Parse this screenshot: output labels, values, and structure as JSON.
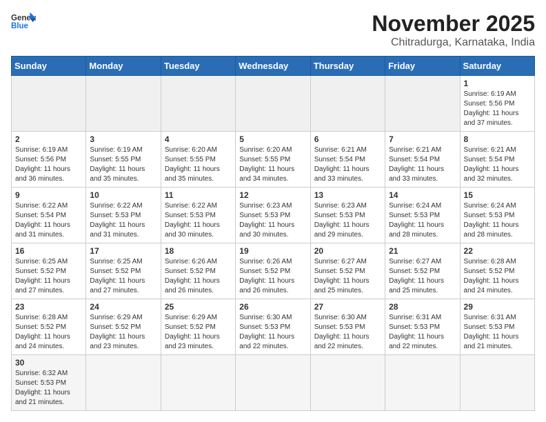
{
  "header": {
    "logo_general": "General",
    "logo_blue": "Blue",
    "month_title": "November 2025",
    "location": "Chitradurga, Karnataka, India"
  },
  "weekdays": [
    "Sunday",
    "Monday",
    "Tuesday",
    "Wednesday",
    "Thursday",
    "Friday",
    "Saturday"
  ],
  "weeks": [
    [
      {
        "day": "",
        "info": ""
      },
      {
        "day": "",
        "info": ""
      },
      {
        "day": "",
        "info": ""
      },
      {
        "day": "",
        "info": ""
      },
      {
        "day": "",
        "info": ""
      },
      {
        "day": "",
        "info": ""
      },
      {
        "day": "1",
        "info": "Sunrise: 6:19 AM\nSunset: 5:56 PM\nDaylight: 11 hours\nand 37 minutes."
      }
    ],
    [
      {
        "day": "2",
        "info": "Sunrise: 6:19 AM\nSunset: 5:56 PM\nDaylight: 11 hours\nand 36 minutes."
      },
      {
        "day": "3",
        "info": "Sunrise: 6:19 AM\nSunset: 5:55 PM\nDaylight: 11 hours\nand 35 minutes."
      },
      {
        "day": "4",
        "info": "Sunrise: 6:20 AM\nSunset: 5:55 PM\nDaylight: 11 hours\nand 35 minutes."
      },
      {
        "day": "5",
        "info": "Sunrise: 6:20 AM\nSunset: 5:55 PM\nDaylight: 11 hours\nand 34 minutes."
      },
      {
        "day": "6",
        "info": "Sunrise: 6:21 AM\nSunset: 5:54 PM\nDaylight: 11 hours\nand 33 minutes."
      },
      {
        "day": "7",
        "info": "Sunrise: 6:21 AM\nSunset: 5:54 PM\nDaylight: 11 hours\nand 33 minutes."
      },
      {
        "day": "8",
        "info": "Sunrise: 6:21 AM\nSunset: 5:54 PM\nDaylight: 11 hours\nand 32 minutes."
      }
    ],
    [
      {
        "day": "9",
        "info": "Sunrise: 6:22 AM\nSunset: 5:54 PM\nDaylight: 11 hours\nand 31 minutes."
      },
      {
        "day": "10",
        "info": "Sunrise: 6:22 AM\nSunset: 5:53 PM\nDaylight: 11 hours\nand 31 minutes."
      },
      {
        "day": "11",
        "info": "Sunrise: 6:22 AM\nSunset: 5:53 PM\nDaylight: 11 hours\nand 30 minutes."
      },
      {
        "day": "12",
        "info": "Sunrise: 6:23 AM\nSunset: 5:53 PM\nDaylight: 11 hours\nand 30 minutes."
      },
      {
        "day": "13",
        "info": "Sunrise: 6:23 AM\nSunset: 5:53 PM\nDaylight: 11 hours\nand 29 minutes."
      },
      {
        "day": "14",
        "info": "Sunrise: 6:24 AM\nSunset: 5:53 PM\nDaylight: 11 hours\nand 28 minutes."
      },
      {
        "day": "15",
        "info": "Sunrise: 6:24 AM\nSunset: 5:53 PM\nDaylight: 11 hours\nand 28 minutes."
      }
    ],
    [
      {
        "day": "16",
        "info": "Sunrise: 6:25 AM\nSunset: 5:52 PM\nDaylight: 11 hours\nand 27 minutes."
      },
      {
        "day": "17",
        "info": "Sunrise: 6:25 AM\nSunset: 5:52 PM\nDaylight: 11 hours\nand 27 minutes."
      },
      {
        "day": "18",
        "info": "Sunrise: 6:26 AM\nSunset: 5:52 PM\nDaylight: 11 hours\nand 26 minutes."
      },
      {
        "day": "19",
        "info": "Sunrise: 6:26 AM\nSunset: 5:52 PM\nDaylight: 11 hours\nand 26 minutes."
      },
      {
        "day": "20",
        "info": "Sunrise: 6:27 AM\nSunset: 5:52 PM\nDaylight: 11 hours\nand 25 minutes."
      },
      {
        "day": "21",
        "info": "Sunrise: 6:27 AM\nSunset: 5:52 PM\nDaylight: 11 hours\nand 25 minutes."
      },
      {
        "day": "22",
        "info": "Sunrise: 6:28 AM\nSunset: 5:52 PM\nDaylight: 11 hours\nand 24 minutes."
      }
    ],
    [
      {
        "day": "23",
        "info": "Sunrise: 6:28 AM\nSunset: 5:52 PM\nDaylight: 11 hours\nand 24 minutes."
      },
      {
        "day": "24",
        "info": "Sunrise: 6:29 AM\nSunset: 5:52 PM\nDaylight: 11 hours\nand 23 minutes."
      },
      {
        "day": "25",
        "info": "Sunrise: 6:29 AM\nSunset: 5:52 PM\nDaylight: 11 hours\nand 23 minutes."
      },
      {
        "day": "26",
        "info": "Sunrise: 6:30 AM\nSunset: 5:53 PM\nDaylight: 11 hours\nand 22 minutes."
      },
      {
        "day": "27",
        "info": "Sunrise: 6:30 AM\nSunset: 5:53 PM\nDaylight: 11 hours\nand 22 minutes."
      },
      {
        "day": "28",
        "info": "Sunrise: 6:31 AM\nSunset: 5:53 PM\nDaylight: 11 hours\nand 22 minutes."
      },
      {
        "day": "29",
        "info": "Sunrise: 6:31 AM\nSunset: 5:53 PM\nDaylight: 11 hours\nand 21 minutes."
      }
    ],
    [
      {
        "day": "30",
        "info": "Sunrise: 6:32 AM\nSunset: 5:53 PM\nDaylight: 11 hours\nand 21 minutes."
      },
      {
        "day": "",
        "info": ""
      },
      {
        "day": "",
        "info": ""
      },
      {
        "day": "",
        "info": ""
      },
      {
        "day": "",
        "info": ""
      },
      {
        "day": "",
        "info": ""
      },
      {
        "day": "",
        "info": ""
      }
    ]
  ]
}
